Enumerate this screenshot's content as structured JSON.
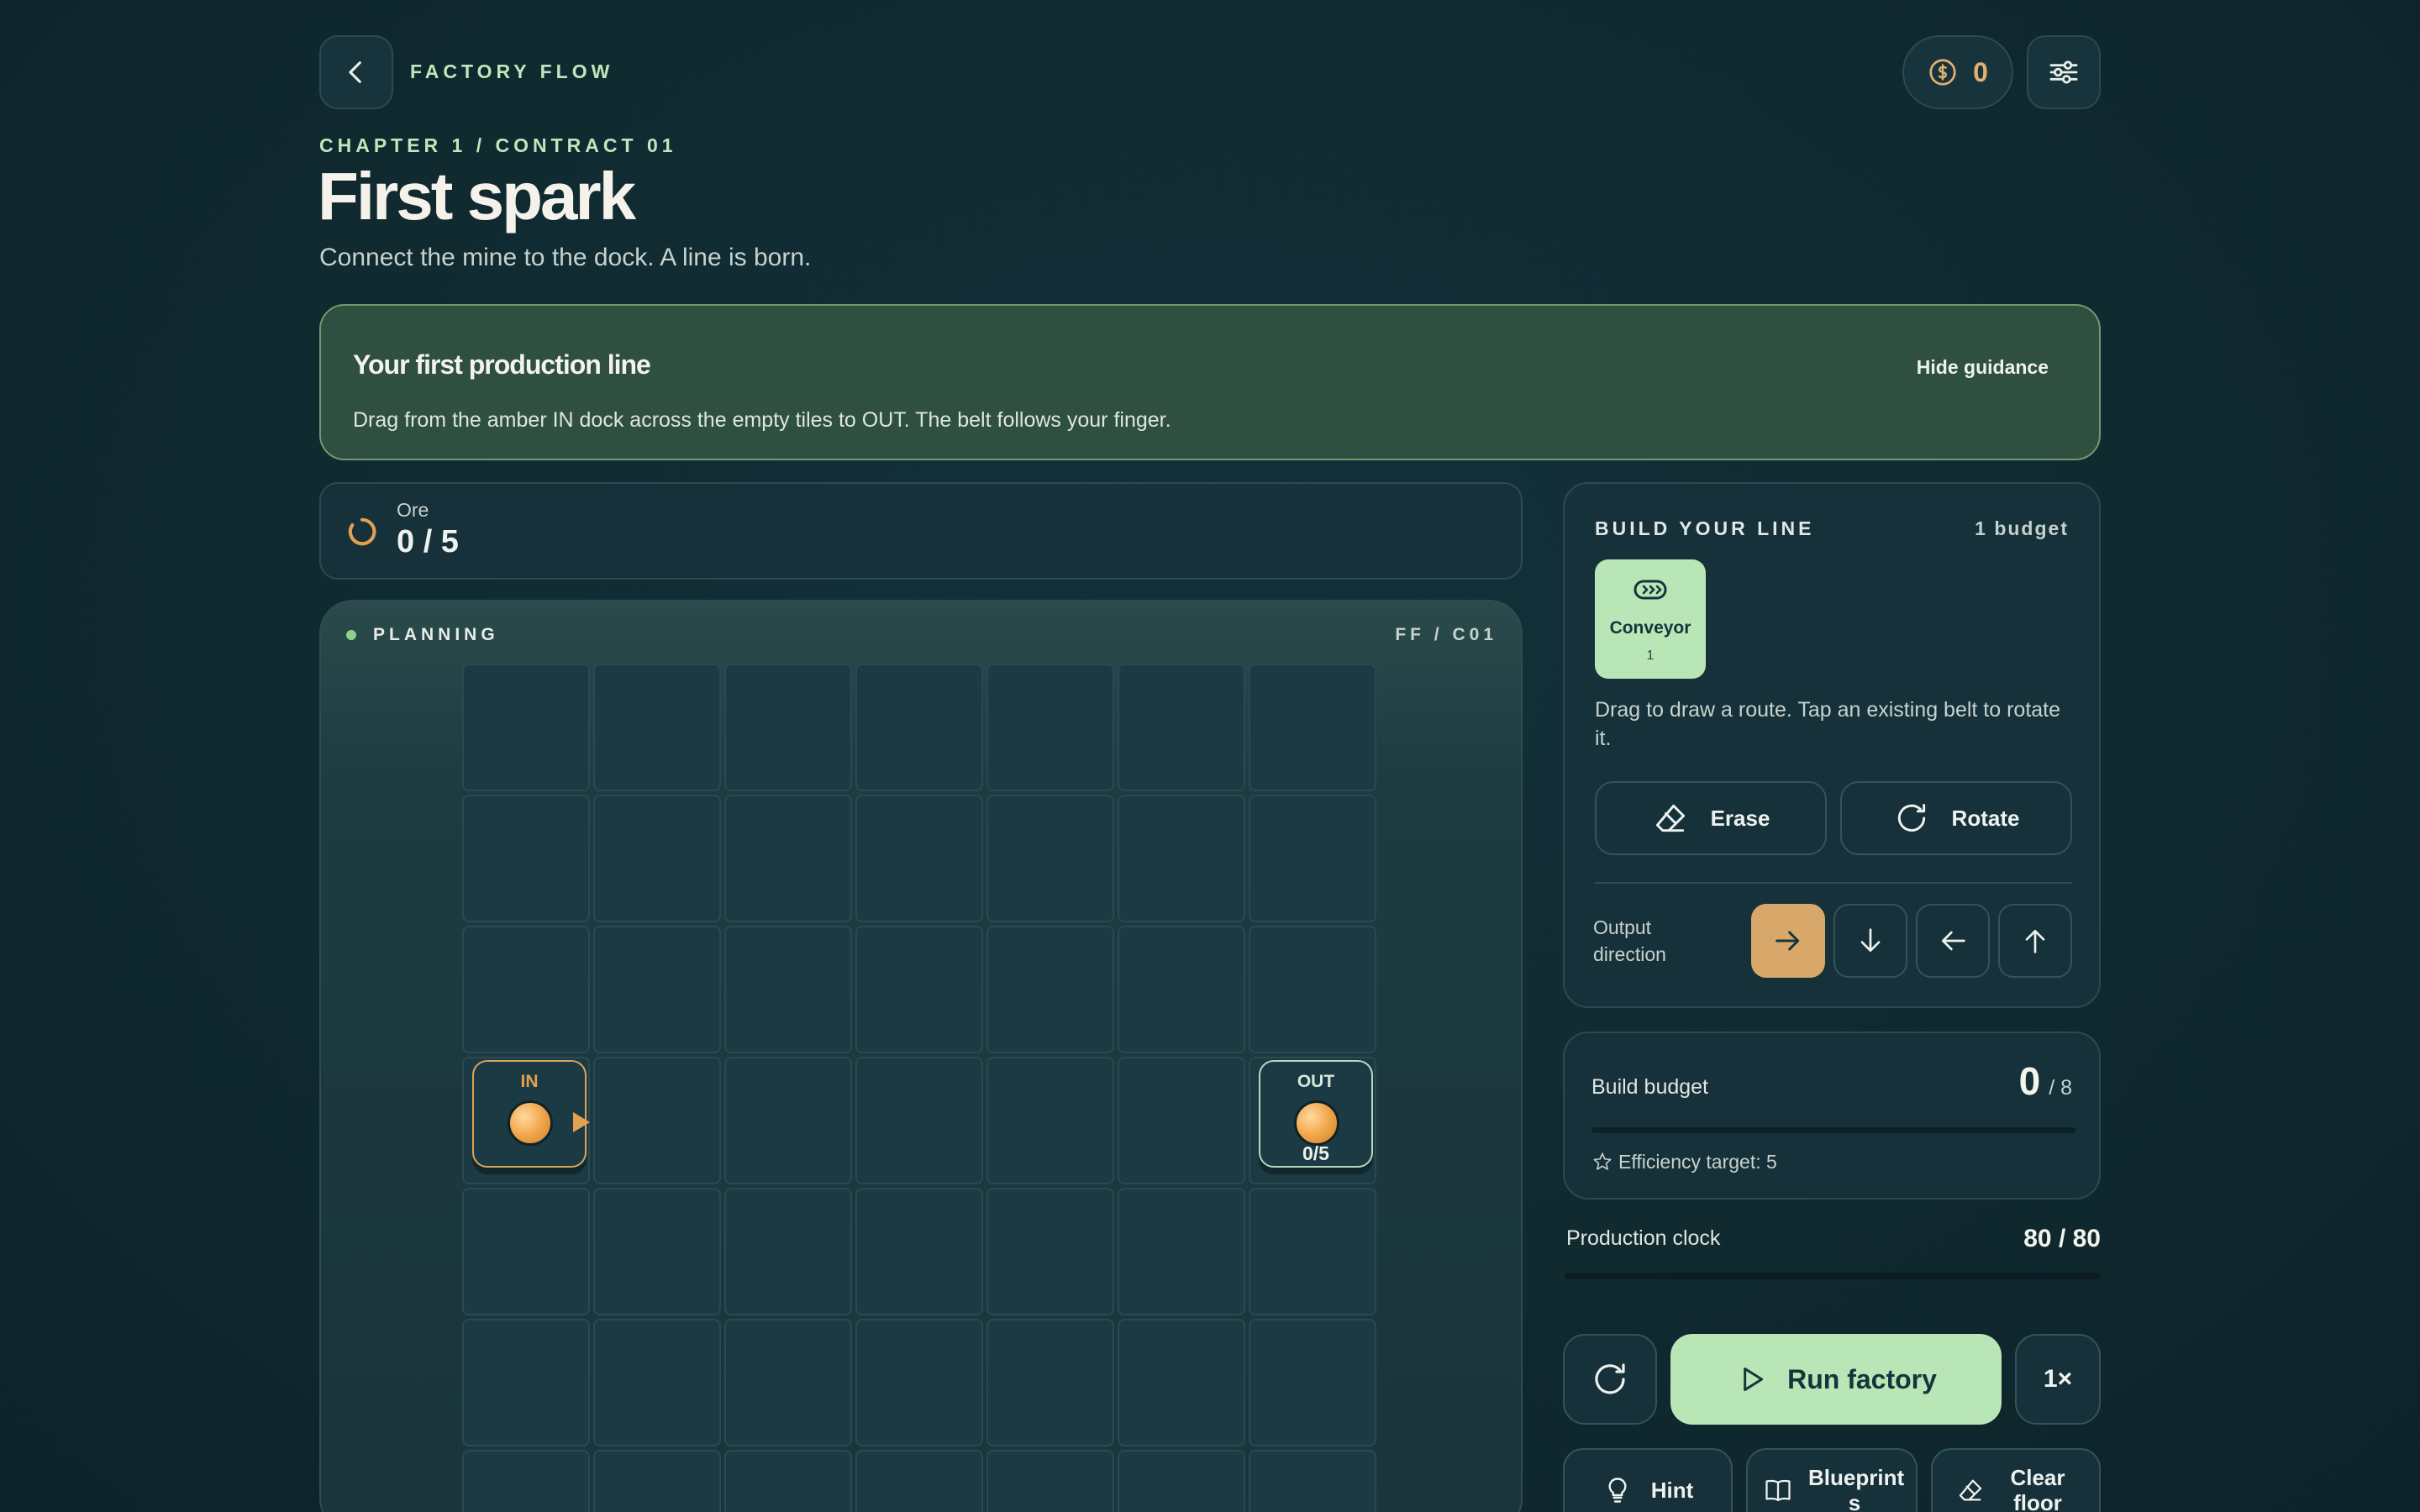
{
  "header": {
    "app_name": "FACTORY FLOW",
    "coins": "0"
  },
  "contract": {
    "eyebrow": "CHAPTER 1 / CONTRACT 01",
    "title": "First spark",
    "subtitle": "Connect the mine to the dock. A line is born."
  },
  "guidance": {
    "title": "Your first production line",
    "body": "Drag from the amber IN dock across the empty tiles to OUT. The belt follows your finger.",
    "hide_label": "Hide guidance"
  },
  "resource": {
    "name": "Ore",
    "progress": "0 / 5"
  },
  "board": {
    "status": "PLANNING",
    "code": "FF / C01",
    "in_label": "IN",
    "out_label": "OUT",
    "out_count": "0/5"
  },
  "build": {
    "title": "BUILD YOUR LINE",
    "budget_label": "1 budget",
    "tool_name": "Conveyor",
    "tool_cost": "1",
    "help": "Drag to draw a route. Tap an existing belt to rotate it.",
    "erase": "Erase",
    "rotate": "Rotate",
    "output_direction": "Output direction"
  },
  "budget": {
    "label": "Build budget",
    "used": "0",
    "total": "/ 8",
    "used_fraction": 0,
    "efficiency": "Efficiency target: 5"
  },
  "clock": {
    "label": "Production clock",
    "value": "80 / 80",
    "remaining_fraction": 1
  },
  "actions": {
    "run": "Run factory",
    "speed": "1×",
    "hint": "Hint",
    "blueprints": "Blueprint s",
    "clear": "Clear floor"
  },
  "colors": {
    "accent_green": "#b9e6b6",
    "accent_amber": "#d7a86a",
    "background": "#102a30"
  }
}
